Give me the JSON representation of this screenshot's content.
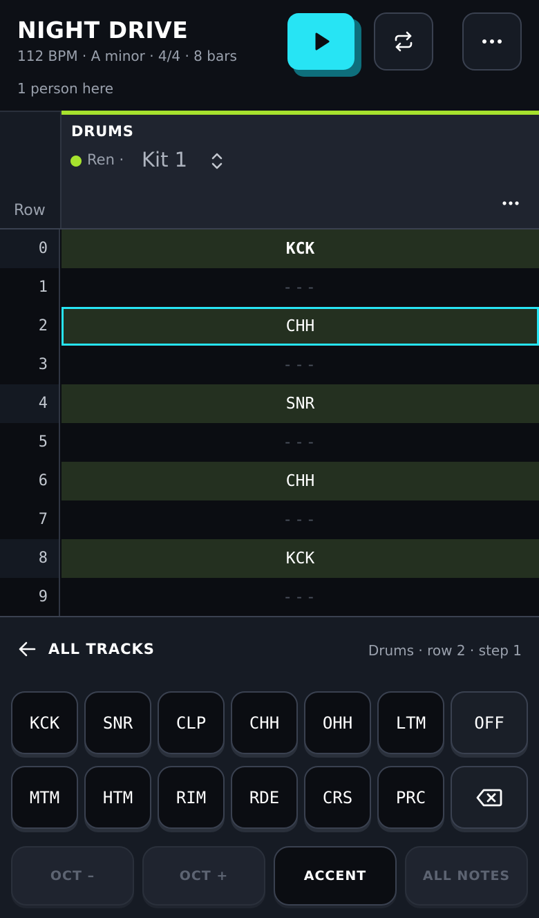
{
  "project": {
    "title": "NIGHT DRIVE",
    "meta": "112 BPM · A minor · 4/4 · 8 bars",
    "presence": "1 person here"
  },
  "toolbar": {
    "play_icon": "play-icon",
    "loop_icon": "loop-icon",
    "more_icon": "more-icon"
  },
  "track": {
    "name": "DRUMS",
    "owner": "Ren ·",
    "instrument": "Kit 1",
    "accent_color": "#a6e22e",
    "row_header": "Row"
  },
  "grid": {
    "rows": [
      {
        "num": "0",
        "value": "KCK"
      },
      {
        "num": "1",
        "value": "---"
      },
      {
        "num": "2",
        "value": "CHH"
      },
      {
        "num": "3",
        "value": "---"
      },
      {
        "num": "4",
        "value": "SNR"
      },
      {
        "num": "5",
        "value": "---"
      },
      {
        "num": "6",
        "value": "CHH"
      },
      {
        "num": "7",
        "value": "---"
      },
      {
        "num": "8",
        "value": "KCK"
      },
      {
        "num": "9",
        "value": "---"
      }
    ],
    "selected_row": 2,
    "cursor_color": "#27e4f4"
  },
  "panel": {
    "back_label": "ALL TRACKS",
    "cursor_info": "Drums · row 2 · step 1",
    "pads_row1": [
      "KCK",
      "SNR",
      "CLP",
      "CHH",
      "OHH",
      "LTM",
      "OFF"
    ],
    "pads_row2": [
      "MTM",
      "HTM",
      "RIM",
      "RDE",
      "CRS",
      "PRC"
    ],
    "modifiers": [
      "OCT –",
      "OCT +",
      "ACCENT",
      "ALL NOTES"
    ],
    "active_modifier": "ACCENT"
  }
}
